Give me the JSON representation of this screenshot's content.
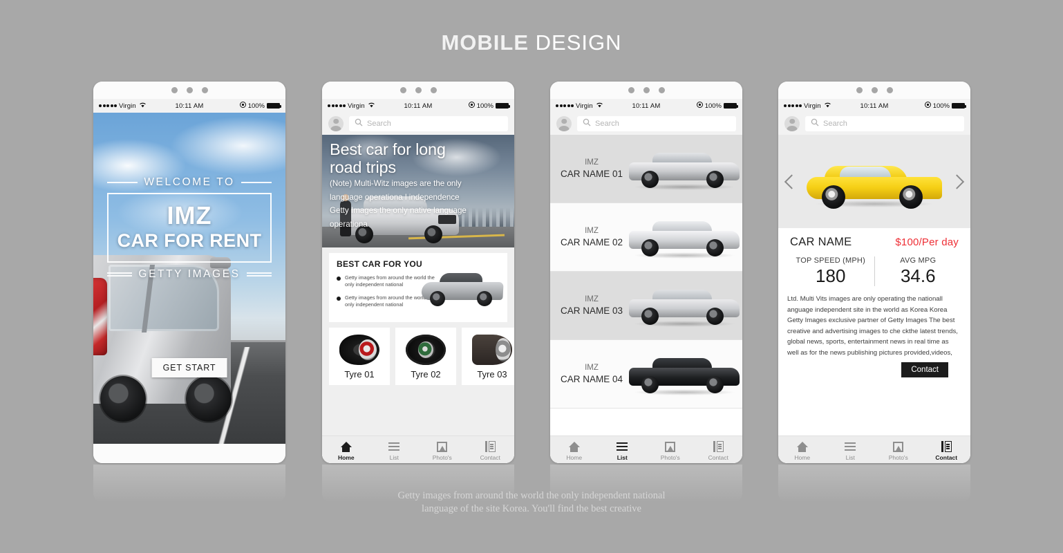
{
  "page": {
    "title_bold": "MOBILE",
    "title_light": " DESIGN",
    "footer_line1": "Getty images from around the world the only independent national",
    "footer_line2": "language of the site Korea. You'll find the best creative"
  },
  "status_bar": {
    "carrier": "Virgin",
    "time": "10:11 AM",
    "battery": "100%"
  },
  "search": {
    "placeholder": "Search"
  },
  "tabbar": {
    "items": [
      {
        "label": "Home",
        "icon": "home-icon"
      },
      {
        "label": "List",
        "icon": "list-icon"
      },
      {
        "label": "Photo's",
        "icon": "photo-icon"
      },
      {
        "label": "Contact",
        "icon": "contact-icon"
      }
    ]
  },
  "screen1": {
    "welcome": "WELCOME TO",
    "brand": "IMZ",
    "tagline": "CAR FOR RENT",
    "credit": "GETTY IMAGES",
    "cta": "GET START"
  },
  "screen2": {
    "hero_title_line1": "Best car for long",
    "hero_title_line2": "road trips",
    "hero_sub_line1": "(Note) Multi-Witz images are the only",
    "hero_sub_line2": "language operationa l independence",
    "hero_sub_line3": "Getty Images the only native language",
    "hero_sub_line4": "operationa",
    "card_title": "BEST CAR FOR YOU",
    "bullets": [
      "Getty images from around the world the only  independent national",
      "Getty images from around the world the only  independent national"
    ],
    "tyres": [
      {
        "label": "Tyre 01"
      },
      {
        "label": "Tyre 02"
      },
      {
        "label": "Tyre 03"
      }
    ],
    "active_tab": "Home"
  },
  "screen3": {
    "cars": [
      {
        "brand": "IMZ",
        "name": "CAR NAME 01",
        "tone": "silver"
      },
      {
        "brand": "IMZ",
        "name": "CAR NAME 02",
        "tone": "lightsilver"
      },
      {
        "brand": "IMZ",
        "name": "CAR NAME 03",
        "tone": "suvtone"
      },
      {
        "brand": "IMZ",
        "name": "CAR NAME 04",
        "tone": "black"
      }
    ],
    "active_tab": "List"
  },
  "screen4": {
    "car_name": "CAR NAME",
    "price": "$100/Per day",
    "price_color": "#ee2e35",
    "spec_left_label": "TOP SPEED (MPH)",
    "spec_left_value": "180",
    "spec_right_label": "AVG MPG",
    "spec_right_value": "34.6",
    "paragraph": "Ltd. Multi Vits images are only operating the nationall anguage independent site in the world as Korea Korea Getty Images exclusive partner of Getty Images The best creative and advertising images to che ckthe latest trends, global news, sports, entertainment news in real time as well as for the news publishing  pictures provided,videos,",
    "contact_button": "Contact",
    "active_tab": "Contact",
    "prev_arrow": "chevron-left-icon",
    "next_arrow": "chevron-right-icon"
  }
}
